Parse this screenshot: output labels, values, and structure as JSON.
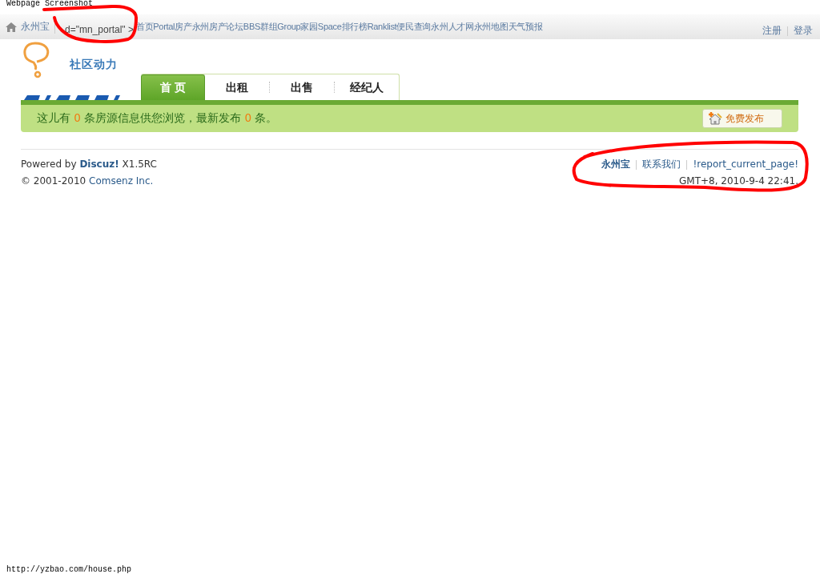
{
  "capture_title": "Webpage Screenshot",
  "topbar": {
    "site": "永州宝",
    "crumb": "d=\"mn_portal\" >",
    "nav": [
      "首页Portal",
      "房产",
      "永州房产论坛BBS",
      "群组Group",
      "家园Space",
      "排行榜Ranklist",
      "便民查询",
      "永州人才网",
      "永州地图",
      "天气预报"
    ],
    "user_links": [
      "注册",
      "登录"
    ]
  },
  "logo": {
    "tagline": "社区动力"
  },
  "tabs": [
    {
      "label": "首 页",
      "selected": true
    },
    {
      "label": "出租",
      "selected": false
    },
    {
      "label": "出售",
      "selected": false
    },
    {
      "label": "经纪人",
      "selected": false
    }
  ],
  "notice": {
    "before": "这儿有",
    "count": "0",
    "middle": "条房源信息供您浏览，最新发布",
    "new_count": "0",
    "after": "条。"
  },
  "post_button": "免费发布",
  "footer": {
    "powered": "Powered by",
    "product": "Discuz!",
    "version": "X1.5RC",
    "copyright": "© 2001-2010",
    "company": "Comsenz Inc.",
    "links": [
      {
        "label": "永州宝",
        "bold": true
      },
      {
        "label": "联系我们",
        "bold": false
      },
      {
        "label": "!report_current_page!",
        "bold": false
      }
    ],
    "time": "GMT+8, 2010-9-4 22:41."
  },
  "status_url": "http://yzbao.com/house.php"
}
